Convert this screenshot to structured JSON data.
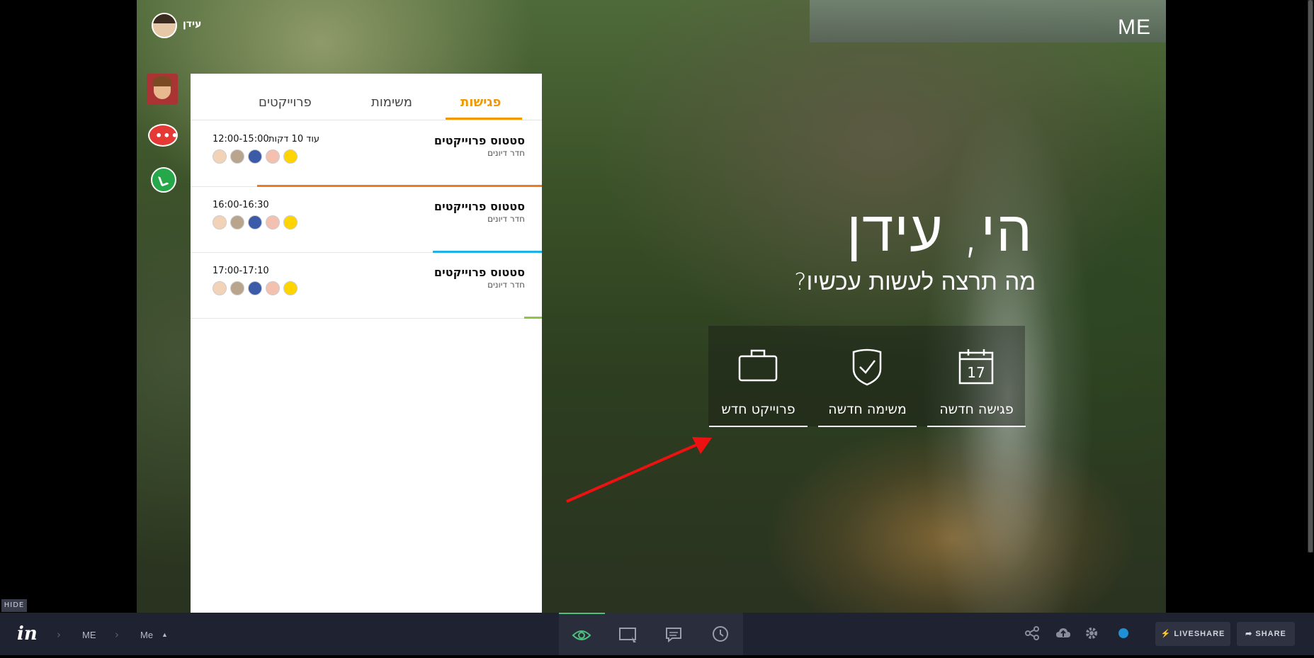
{
  "user": {
    "name": "עידן"
  },
  "brand": {
    "logo_text": "ME"
  },
  "tabs": [
    {
      "label": "פגישות",
      "active": true
    },
    {
      "label": "משימות",
      "active": false
    },
    {
      "label": "פרוייקטים",
      "active": false
    }
  ],
  "meetings": [
    {
      "title": "סטטוס פרוייקטים",
      "room": "חדר דיונים",
      "time": "12:00-15:00",
      "extra": "עוד 10 דקות",
      "bar_color": "#f07a1a",
      "bar_fill": 0.81
    },
    {
      "title": "סטטוס פרוייקטים",
      "room": "חדר דיונים",
      "time": "16:00-16:30",
      "extra": "",
      "bar_color": "#1fb1e6",
      "bar_fill": 0.31
    },
    {
      "title": "סטטוס פרוייקטים",
      "room": "חדר דיונים",
      "time": "17:00-17:10",
      "extra": "",
      "bar_color": "#8dc63f",
      "bar_fill": 0.05
    }
  ],
  "greeting": {
    "hello": "הי, עידן",
    "question": "מה תרצה לעשות עכשיו?"
  },
  "actions": [
    {
      "label": "פגישה חדשה",
      "icon": "calendar-icon",
      "date": "17"
    },
    {
      "label": "משימה חדשה",
      "icon": "shield-check-icon"
    },
    {
      "label": "פרוייקט חדש",
      "icon": "briefcase-icon"
    }
  ],
  "toolbar": {
    "hide_label": "HIDE",
    "logo": "in",
    "breadcrumb": [
      "ME",
      "Me"
    ],
    "liveshare_label": "LIVESHARE",
    "share_label": "SHARE",
    "accent_color": "#4ec07d"
  }
}
